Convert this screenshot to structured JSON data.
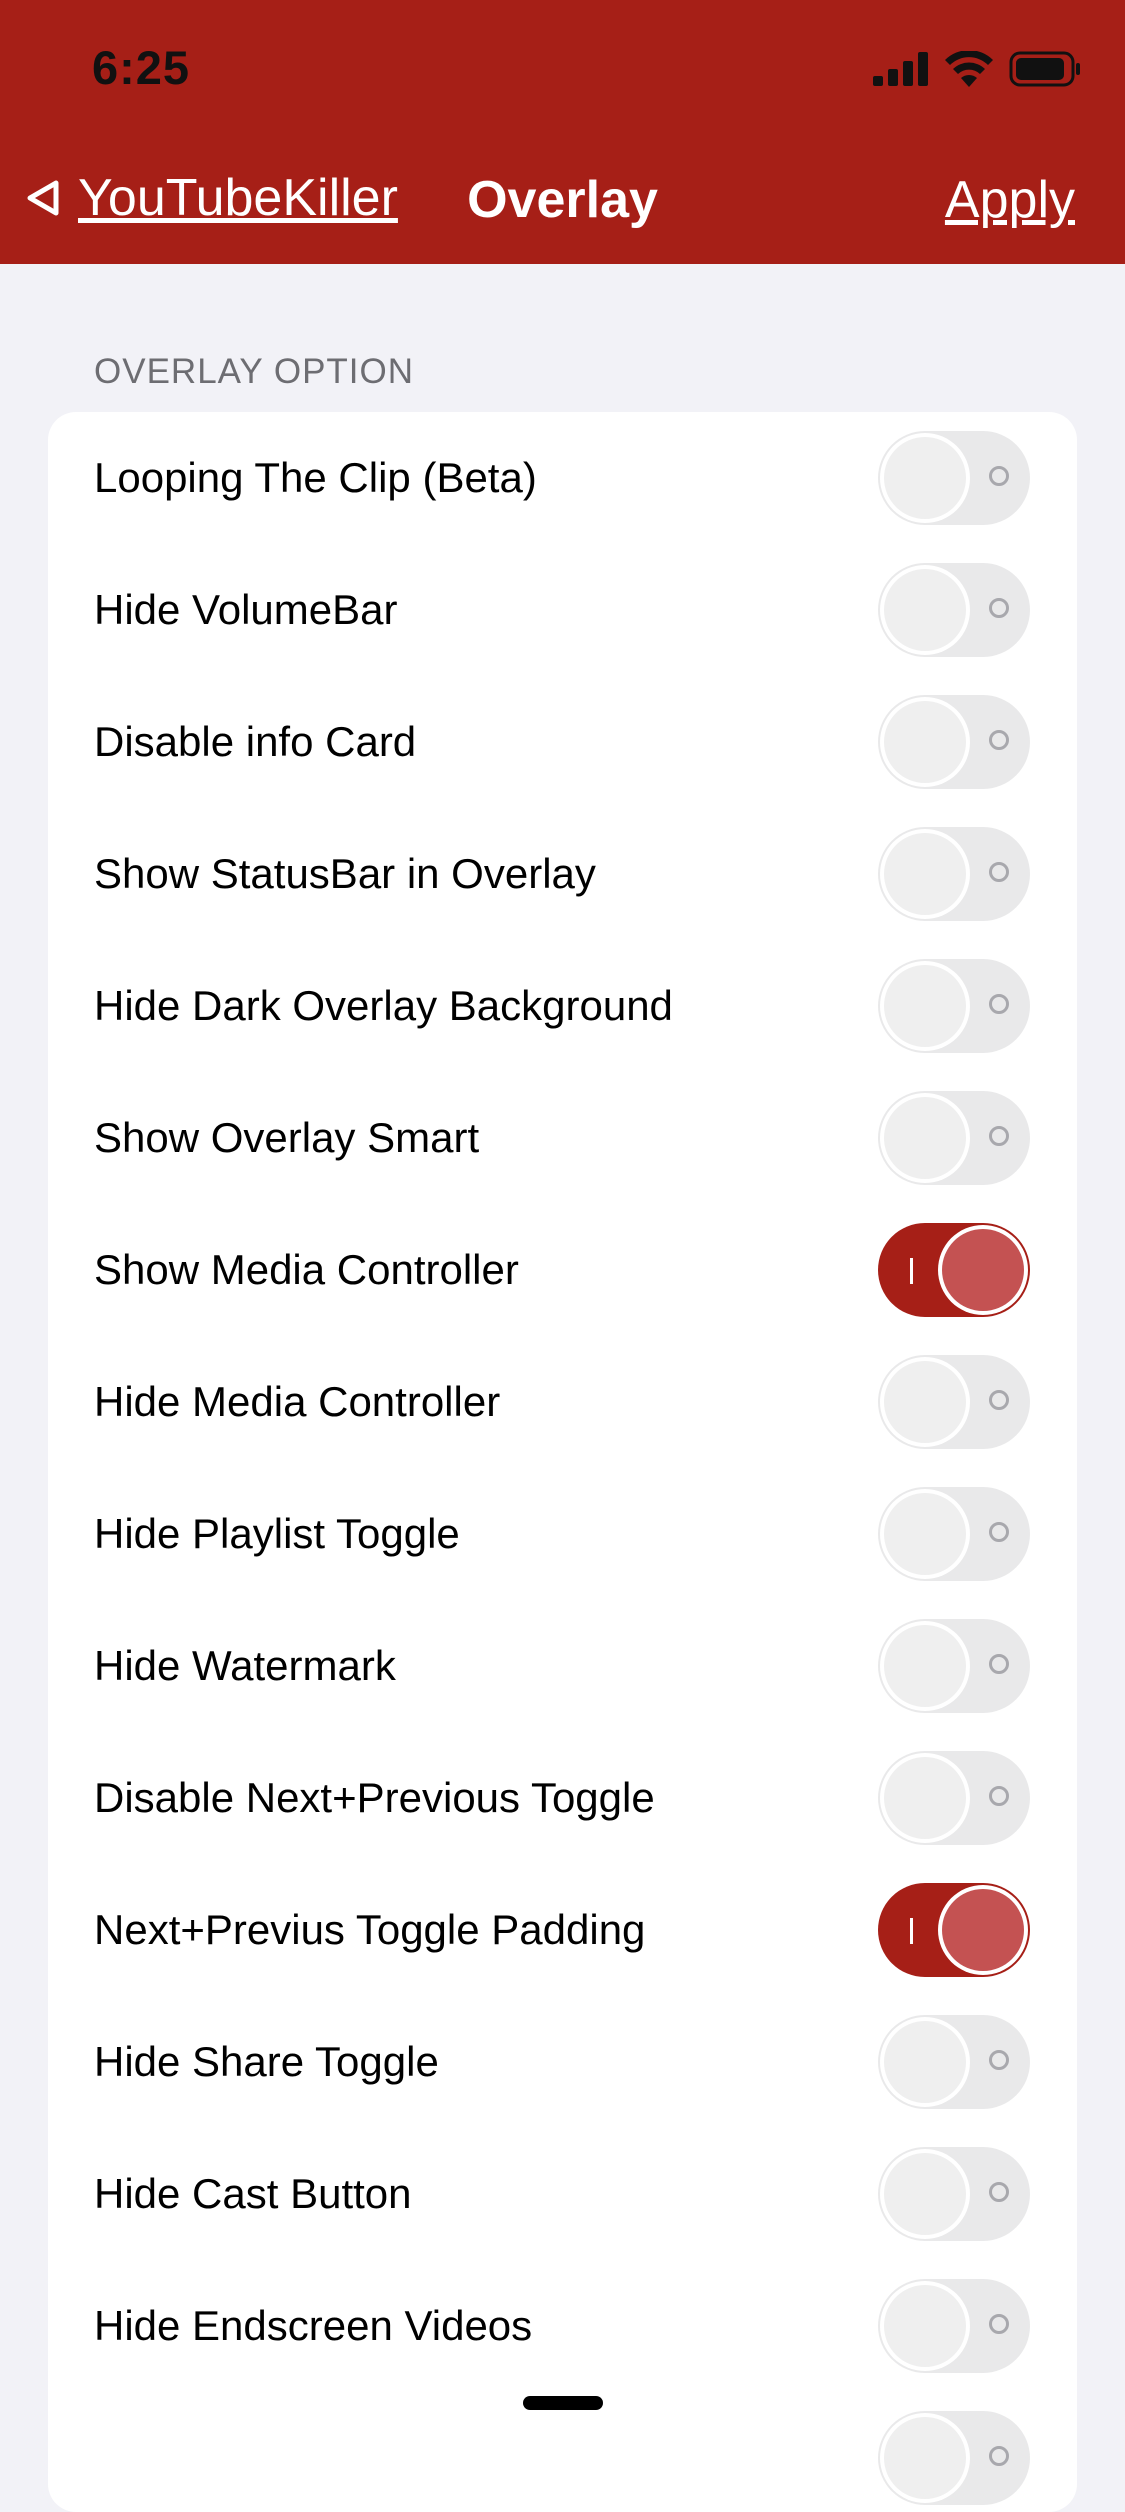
{
  "status_bar": {
    "time": "6:25"
  },
  "nav": {
    "back_label": "YouTubeKiller",
    "title": "Overlay",
    "apply_label": "Apply"
  },
  "section": {
    "header": "OVERLAY OPTION",
    "rows": [
      {
        "label": "Looping The Clip (Beta)",
        "on": false
      },
      {
        "label": "Hide VolumeBar",
        "on": false
      },
      {
        "label": "Disable info Card",
        "on": false
      },
      {
        "label": "Show StatusBar in Overlay",
        "on": false
      },
      {
        "label": "Hide Dark Overlay Background",
        "on": false
      },
      {
        "label": "Show Overlay Smart",
        "on": false
      },
      {
        "label": "Show Media Controller",
        "on": true
      },
      {
        "label": "Hide Media Controller",
        "on": false
      },
      {
        "label": "Hide Playlist Toggle",
        "on": false
      },
      {
        "label": "Hide Watermark",
        "on": false
      },
      {
        "label": "Disable Next+Previous Toggle",
        "on": false
      },
      {
        "label": "Next+Previus Toggle Padding",
        "on": true
      },
      {
        "label": "Hide Share Toggle",
        "on": false
      },
      {
        "label": "Hide Cast Button",
        "on": false
      },
      {
        "label": "Hide Endscreen Videos",
        "on": false
      },
      {
        "label": "",
        "on": false
      }
    ]
  },
  "colors": {
    "accent": "#a61f17",
    "background": "#f2f2f7",
    "knob_on": "#c45252"
  },
  "icons": {
    "back": "chevron-left-icon",
    "signal": "cellular-signal-icon",
    "wifi": "wifi-icon",
    "battery": "battery-icon"
  }
}
